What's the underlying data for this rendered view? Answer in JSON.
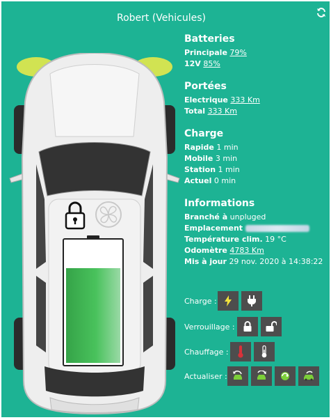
{
  "header": {
    "title": "Robert (Vehicules)"
  },
  "batteries": {
    "heading": "Batteries",
    "principale_label": "Principale",
    "principale_value": "79%",
    "v12_label": "12V",
    "v12_value": "85%",
    "gauge_level": 0.79
  },
  "portees": {
    "heading": "Portées",
    "electrique_label": "Electrique",
    "electrique_value": "333 Km",
    "total_label": "Total",
    "total_value": "333 Km"
  },
  "charge": {
    "heading": "Charge",
    "rapide_label": "Rapide",
    "rapide_value": "1 min",
    "mobile_label": "Mobile",
    "mobile_value": "3 min",
    "station_label": "Station",
    "station_value": "1 min",
    "actuel_label": "Actuel",
    "actuel_value": "0 min"
  },
  "informations": {
    "heading": "Informations",
    "branche_label": "Branché à",
    "branche_value": "unpluged",
    "emplacement_label": "Emplacement",
    "temperature_label": "Température clim.",
    "temperature_value": "19 °C",
    "odometre_label": "Odomètre",
    "odometre_value": "4783 Km",
    "maj_label": "Mis à jour",
    "maj_value": "29 nov. 2020 à 14:38:22"
  },
  "controls": {
    "charge_label": "Charge :",
    "verrouillage_label": "Verrouillage :",
    "chauffage_label": "Chauffage :",
    "actualiser_label": "Actualiser :"
  },
  "icons": {
    "refresh": "refresh-icon",
    "lock": "padlock-icon",
    "fan": "fan-icon",
    "bolt": "lightning-icon",
    "plug": "plug-icon",
    "lock_closed": "lock-closed-icon",
    "lock_open": "lock-open-icon",
    "thermo_hot": "thermometer-hot-icon",
    "thermo_cold": "thermometer-icon"
  },
  "colors": {
    "panel": "#1db394",
    "button": "#4d4d4d",
    "battery_fill": "#2db34a",
    "headlight": "#e5e84a",
    "hot": "#d9323a",
    "car_refresh_green": "#7ccf39"
  }
}
